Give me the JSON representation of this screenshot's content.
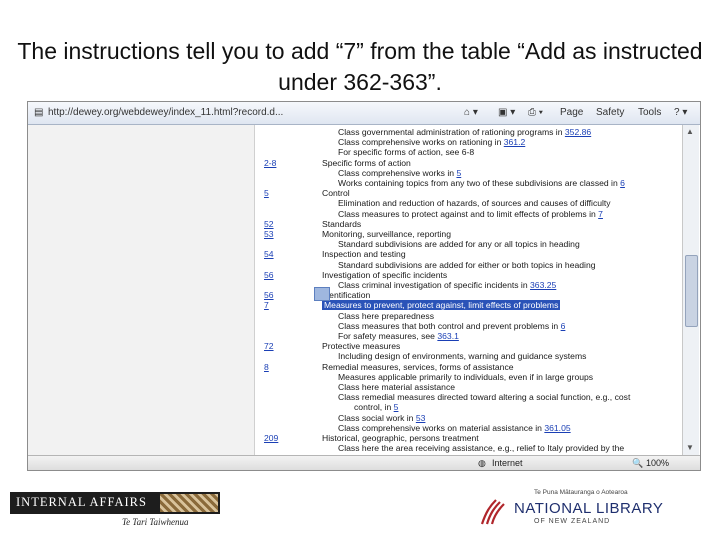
{
  "slide": {
    "title": "The instructions tell you to add “7” from the table “Add as instructed under 362-363”."
  },
  "browser": {
    "address": "http://dewey.org/webdewey/index_11.html?record.d...",
    "page_menu": "Page",
    "safety_menu": "Safety",
    "tools_menu": "Tools",
    "status_zone": "Internet",
    "zoom": "100%"
  },
  "schedule": {
    "rows": [
      {
        "num": "",
        "text": "Class governmental administration of rationing programs in",
        "link": "352.86",
        "indent": 1
      },
      {
        "num": "",
        "text": "Class comprehensive works on rationing in",
        "link": "361.2",
        "indent": 1
      },
      {
        "num": "",
        "text": "For specific forms of action, see 6-8",
        "link": "",
        "indent": 1
      },
      {
        "num": "2-8",
        "text": "Specific forms of action",
        "link": "",
        "indent": 0
      },
      {
        "num": "",
        "text": "Class comprehensive works in",
        "link": "5",
        "indent": 1
      },
      {
        "num": "",
        "text": "Works containing topics from any two of these subdivisions are classed in",
        "link": "6",
        "indent": 1
      },
      {
        "num": "5",
        "text": "Control",
        "link": "",
        "indent": 0
      },
      {
        "num": "",
        "text": "Elimination and reduction of hazards, of sources and causes of difficulty",
        "link": "",
        "indent": 1
      },
      {
        "num": "",
        "text": "Class measures to protect against and to limit effects of problems in",
        "link": "7",
        "indent": 1
      },
      {
        "num": "52",
        "text": "Standards",
        "link": "",
        "indent": 0
      },
      {
        "num": "53",
        "text": "Monitoring, surveillance, reporting",
        "link": "",
        "indent": 0
      },
      {
        "num": "",
        "text": "Standard subdivisions are added for any or all topics in heading",
        "link": "",
        "indent": 1
      },
      {
        "num": "54",
        "text": "Inspection and testing",
        "link": "",
        "indent": 0
      },
      {
        "num": "",
        "text": "Standard subdivisions are added for either or both topics in heading",
        "link": "",
        "indent": 1
      },
      {
        "num": "56",
        "text": "Investigation of specific incidents",
        "link": "",
        "indent": 0
      },
      {
        "num": "",
        "text": "Class criminal investigation of specific incidents in",
        "link": "363.25",
        "indent": 1
      },
      {
        "num": "56",
        "text": "Identification",
        "link": "",
        "indent": 0
      },
      {
        "num": "7",
        "text": "Measures to prevent, protect against, limit effects of problems",
        "link": "",
        "indent": 0,
        "highlight": true
      },
      {
        "num": "",
        "text": "Class here preparedness",
        "link": "",
        "indent": 1
      },
      {
        "num": "",
        "text": "Class measures that both control and prevent problems in",
        "link": "6",
        "indent": 1
      },
      {
        "num": "",
        "text": "For safety measures, see",
        "link": "363.1",
        "indent": 1
      },
      {
        "num": "72",
        "text": "Protective measures",
        "link": "",
        "indent": 0
      },
      {
        "num": "",
        "text": "Including design of environments, warning and guidance systems",
        "link": "",
        "indent": 1
      },
      {
        "num": "8",
        "text": "Remedial measures, services, forms of assistance",
        "link": "",
        "indent": 0
      },
      {
        "num": "",
        "text": "Measures applicable primarily to individuals, even if in large groups",
        "link": "",
        "indent": 1
      },
      {
        "num": "",
        "text": "Class here material assistance",
        "link": "",
        "indent": 1
      },
      {
        "num": "",
        "text": "Class remedial measures directed toward altering a social function, e.g., cost",
        "link": "",
        "indent": 1
      },
      {
        "num": "",
        "text": "control, in",
        "link": "5",
        "indent": 2
      },
      {
        "num": "",
        "text": "Class social work in",
        "link": "53",
        "indent": 1
      },
      {
        "num": "",
        "text": "Class comprehensive works on material assistance in",
        "link": "361.05",
        "indent": 1
      },
      {
        "num": "209",
        "text": "Historical, geographic, persons treatment",
        "link": "",
        "indent": 0
      },
      {
        "num": "",
        "text": "Class here the area receiving assistance, e.g., relief to Italy provided by the",
        "link": "",
        "indent": 1
      }
    ]
  },
  "logos": {
    "internal_affairs": "INTERNAL AFFAIRS",
    "internal_affairs_maori": "Te Tari Taiwhenua",
    "nl_tagline": "Te Puna Mātauranga o Aotearoa",
    "nl_name": "NATIONAL LIBRARY",
    "nl_sub": "OF NEW ZEALAND"
  }
}
